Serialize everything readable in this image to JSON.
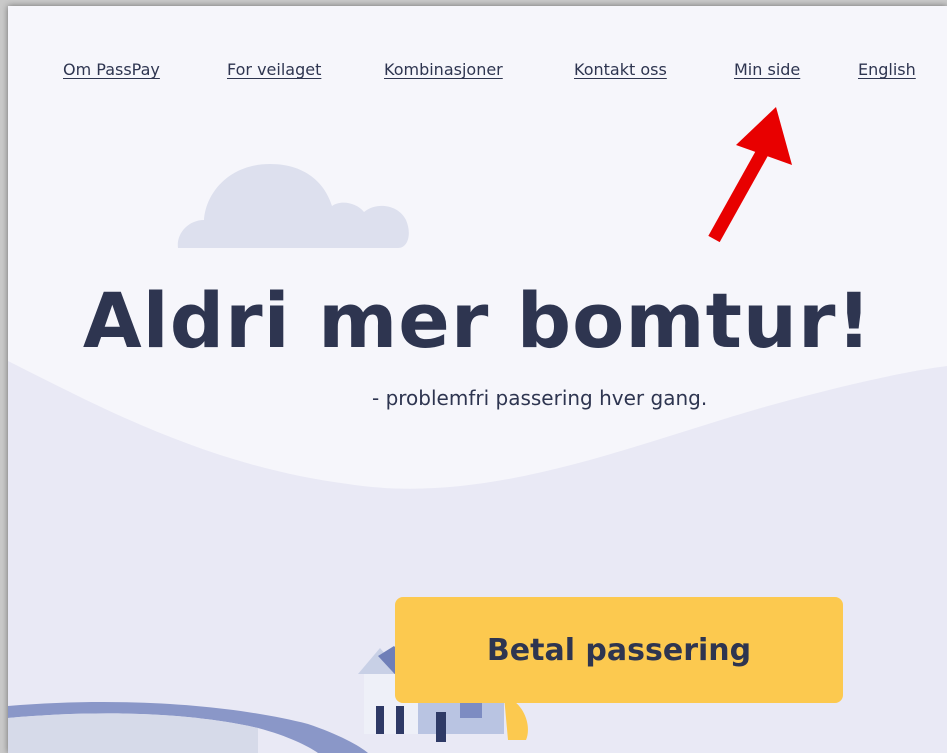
{
  "nav": {
    "items": [
      {
        "label": "Om PassPay"
      },
      {
        "label": "For veilaget"
      },
      {
        "label": "Kombinasjoner"
      },
      {
        "label": "Kontakt oss"
      },
      {
        "label": "Min side"
      },
      {
        "label": "English"
      }
    ]
  },
  "hero": {
    "title": "Aldri mer bomtur!",
    "subtitle": "- problemfri passering hver gang."
  },
  "cta": {
    "label": "Betal passering"
  },
  "colors": {
    "text": "#2e3550",
    "cta_bg": "#fcc94f",
    "page_bg": "#f6f6fb",
    "cloud": "#dde0ee",
    "hill": "#e9e9f5",
    "road": "#8a97c8",
    "annotation_arrow": "#e80000"
  },
  "icons": {
    "cloud": "cloud-icon",
    "house": "house-icon",
    "arrow": "red-arrow-icon"
  }
}
